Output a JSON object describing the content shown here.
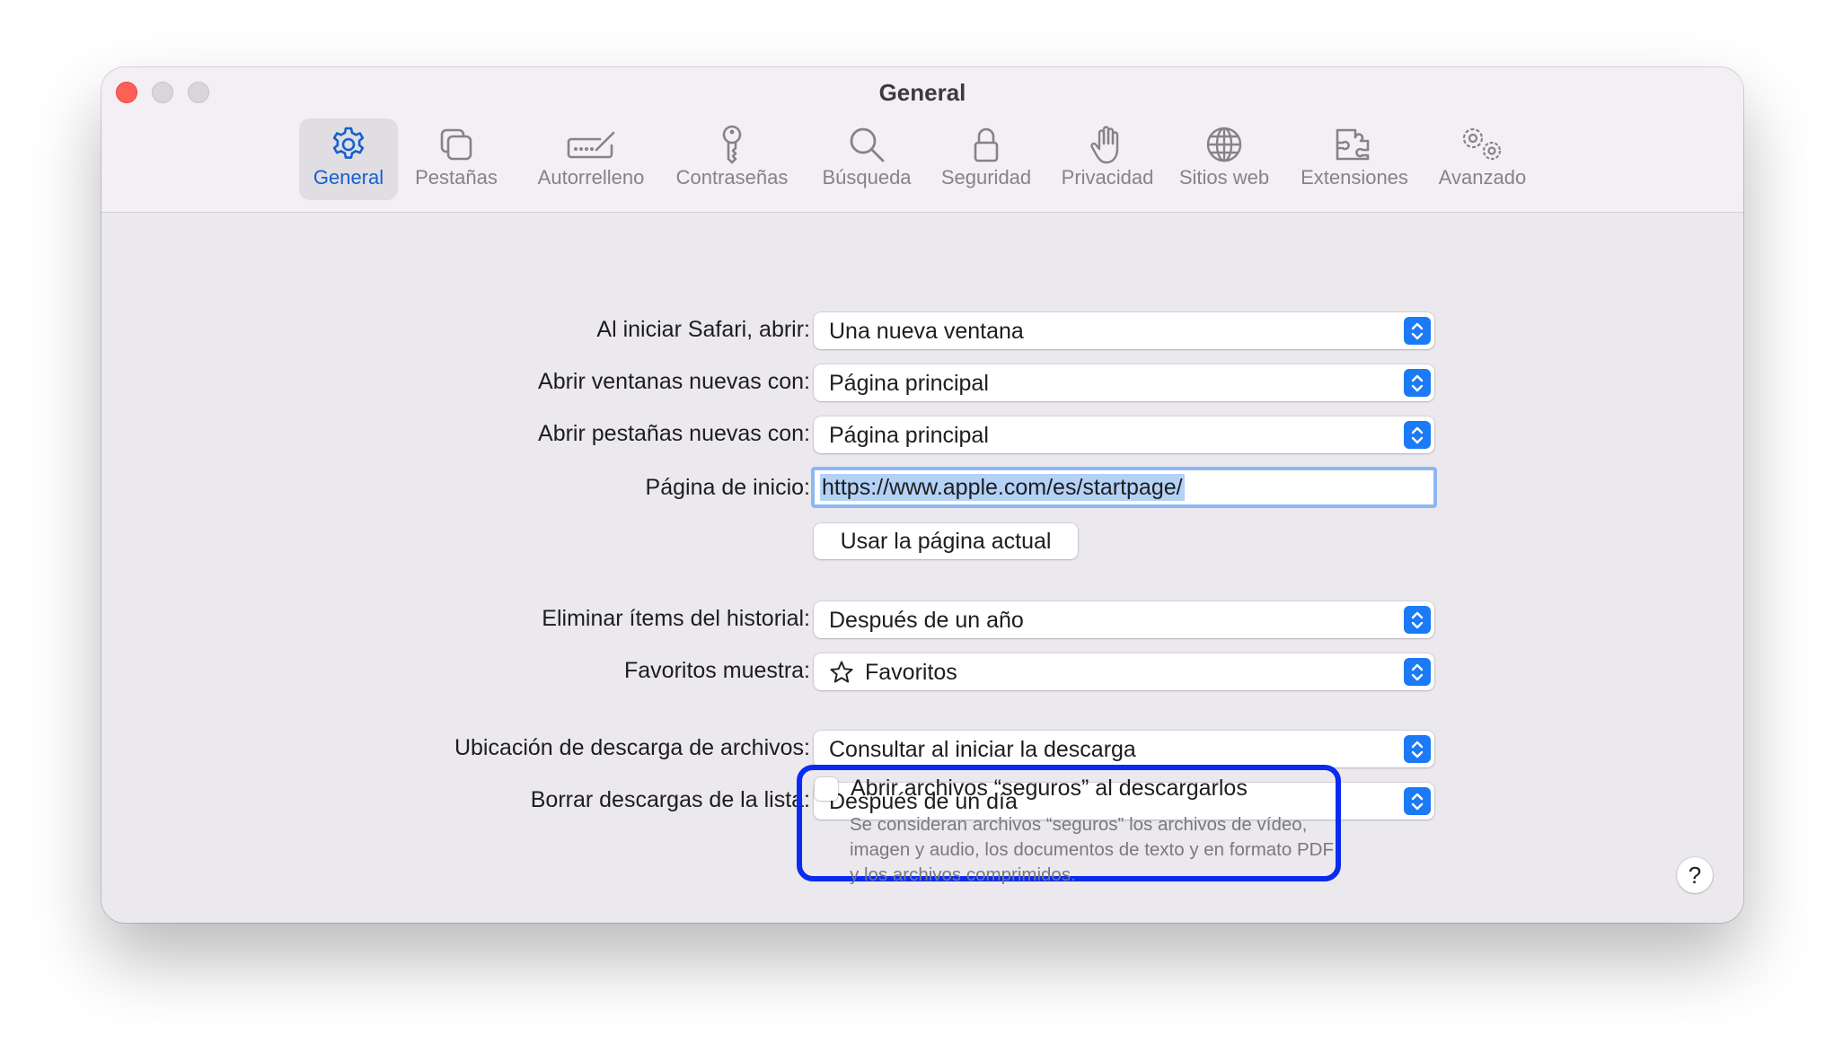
{
  "window": {
    "title": "General"
  },
  "toolbar": {
    "items": [
      {
        "label": "General",
        "icon": "gear-icon",
        "selected": true
      },
      {
        "label": "Pestañas",
        "icon": "tabs-icon"
      },
      {
        "label": "Autorrelleno",
        "icon": "autofill-icon"
      },
      {
        "label": "Contraseñas",
        "icon": "key-icon"
      },
      {
        "label": "Búsqueda",
        "icon": "magnifier-icon"
      },
      {
        "label": "Seguridad",
        "icon": "lock-icon"
      },
      {
        "label": "Privacidad",
        "icon": "hand-icon"
      },
      {
        "label": "Sitios web",
        "icon": "globe-icon"
      },
      {
        "label": "Extensiones",
        "icon": "puzzle-icon"
      },
      {
        "label": "Avanzado",
        "icon": "gears-icon"
      }
    ]
  },
  "settings": {
    "open_with": {
      "label": "Al iniciar Safari, abrir:",
      "value": "Una nueva ventana"
    },
    "new_windows": {
      "label": "Abrir ventanas nuevas con:",
      "value": "Página principal"
    },
    "new_tabs": {
      "label": "Abrir pestañas nuevas con:",
      "value": "Página principal"
    },
    "homepage": {
      "label": "Página de inicio:",
      "value": "https://www.apple.com/es/startpage/"
    },
    "use_current_button": "Usar la página actual",
    "remove_history": {
      "label": "Eliminar ítems del historial:",
      "value": "Después de un año"
    },
    "favorites_shows": {
      "label": "Favoritos muestra:",
      "value": "Favoritos",
      "icon": "star-icon"
    },
    "download_location": {
      "label": "Ubicación de descarga de archivos:",
      "value": "Consultar al iniciar la descarga"
    },
    "remove_downloads": {
      "label": "Borrar descargas de la lista:",
      "value": "Después de un día"
    },
    "open_safe_files": {
      "label": "Abrir archivos “seguros” al descargarlos",
      "checked": false,
      "description": "Se consideran archivos “seguros” los archivos de vídeo, imagen y audio, los documentos de texto y en formato PDF y los archivos comprimidos."
    },
    "help_button": "?"
  },
  "colors": {
    "accent": "#1b7af5",
    "highlight_border": "#0a2bf0",
    "close_button": "#fe5f57"
  }
}
